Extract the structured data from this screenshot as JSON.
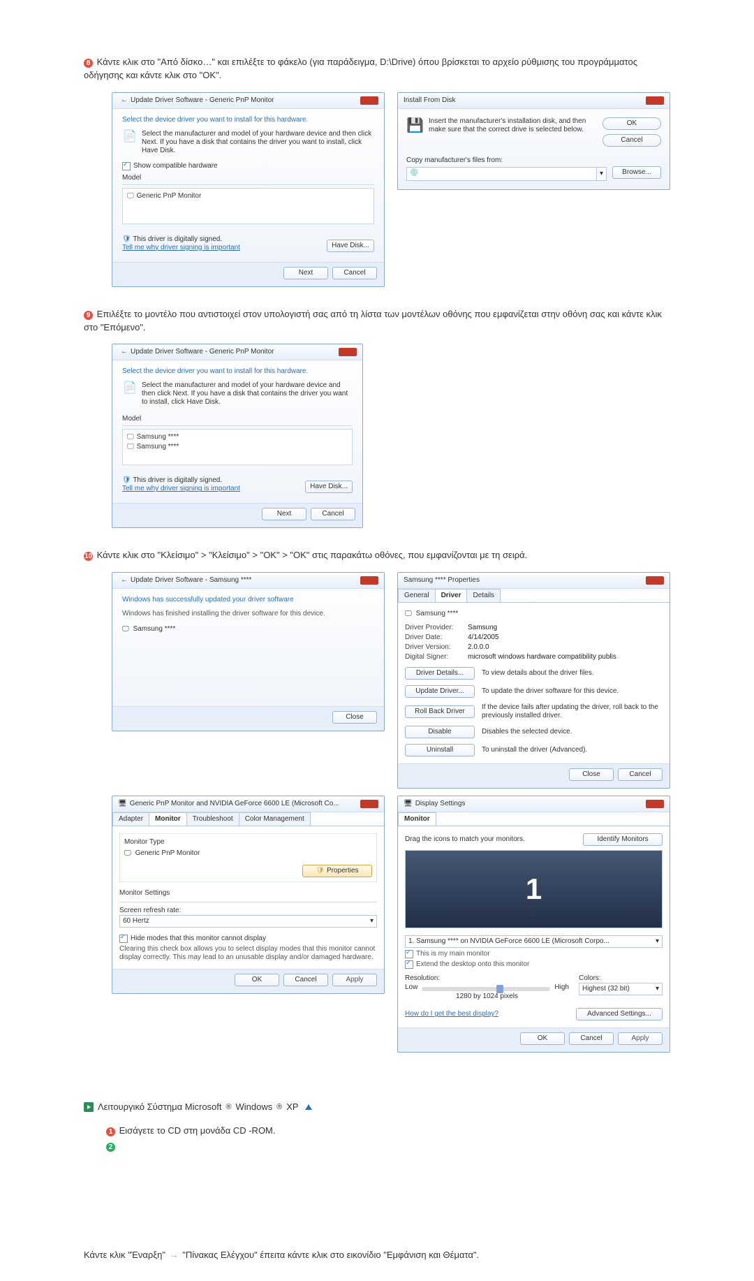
{
  "step8": {
    "text": "Κάντε κλικ στο \"Από δίσκο…\" και επιλέξτε το φάκελο (για παράδειγμα, D:\\Drive) όπου βρίσκεται το αρχείο ρύθμισης του προγράμματος οδήγησης και κάντε κλικ στο \"OK\"."
  },
  "updDrv": {
    "title": "Update Driver Software - Generic PnP Monitor",
    "heading": "Select the device driver you want to install for this hardware.",
    "desc": "Select the manufacturer and model of your hardware device and then click Next. If you have a disk that contains the driver you want to install, click Have Disk.",
    "showCompat": "Show compatible hardware",
    "modelLabel": "Model",
    "items": [
      "Generic PnP Monitor"
    ],
    "signed": "This driver is digitally signed.",
    "signedLink": "Tell me why driver signing is important",
    "haveDisk": "Have Disk...",
    "next": "Next",
    "cancel": "Cancel"
  },
  "ifd": {
    "title": "Install From Disk",
    "desc": "Insert the manufacturer's installation disk, and then make sure that the correct drive is selected below.",
    "ok": "OK",
    "cancel": "Cancel",
    "copyFrom": "Copy manufacturer's files from:",
    "browse": "Browse..."
  },
  "step9": {
    "text": "Επιλέξτε το μοντέλο που αντιστοιχεί στον υπολογιστή σας από τη λίστα των μοντέλων οθόνης που εμφανίζεται στην οθόνη σας και κάντε κλικ στο \"Επόμενο\"."
  },
  "updDrv2": {
    "items": [
      "Samsung ****",
      "Samsung ****"
    ]
  },
  "step10": {
    "text": "Κάντε κλικ στο \"Κλείσιμο\" > \"Κλείσιμο\" > \"OK\" > \"OK\" στις παρακάτω οθόνες, που εμφανίζονται με τη σειρά."
  },
  "updDrv3": {
    "title": "Update Driver Software - Samsung ****",
    "heading": "Windows has successfully updated your driver software",
    "desc": "Windows has finished installing the driver software for this device.",
    "item": "Samsung ****",
    "close": "Close"
  },
  "props": {
    "title": "Samsung **** Properties",
    "tabs": [
      "General",
      "Driver",
      "Details"
    ],
    "device": "Samsung ****",
    "provider_k": "Driver Provider:",
    "provider_v": "Samsung",
    "date_k": "Driver Date:",
    "date_v": "4/14/2005",
    "version_k": "Driver Version:",
    "version_v": "2.0.0.0",
    "signer_k": "Digital Signer:",
    "signer_v": "microsoft windows hardware compatibility publis",
    "btn_details": "Driver Details...",
    "btn_details_t": "To view details about the driver files.",
    "btn_update": "Update Driver...",
    "btn_update_t": "To update the driver software for this device.",
    "btn_rollback": "Roll Back Driver",
    "btn_rollback_t": "If the device fails after updating the driver, roll back to the previously installed driver.",
    "btn_disable": "Disable",
    "btn_disable_t": "Disables the selected device.",
    "btn_uninstall": "Uninstall",
    "btn_uninstall_t": "To uninstall the driver (Advanced).",
    "close": "Close",
    "cancel": "Cancel"
  },
  "monProps": {
    "title": "Generic PnP Monitor and NVIDIA GeForce 6600 LE (Microsoft Co...",
    "tabs": [
      "Adapter",
      "Monitor",
      "Troubleshoot",
      "Color Management"
    ],
    "typeLabel": "Monitor Type",
    "typeVal": "Generic PnP Monitor",
    "propertiesBtn": "Properties",
    "settingsLabel": "Monitor Settings",
    "refreshLabel": "Screen refresh rate:",
    "refreshVal": "60 Hertz",
    "hideModes": "Hide modes that this monitor cannot display",
    "hideModesDesc": "Clearing this check box allows you to select display modes that this monitor cannot display correctly. This may lead to an unusable display and/or damaged hardware.",
    "ok": "OK",
    "cancel": "Cancel",
    "apply": "Apply"
  },
  "dispSet": {
    "title": "Display Settings",
    "tab": "Monitor",
    "drag": "Drag the icons to match your monitors.",
    "identify": "Identify Monitors",
    "monitorSel": "1. Samsung **** on NVIDIA GeForce 6600 LE (Microsoft Corpo...",
    "main": "This is my main monitor",
    "extend": "Extend the desktop onto this monitor",
    "resLabel": "Resolution:",
    "low": "Low",
    "high": "High",
    "resVal": "1280 by 1024 pixels",
    "colorsLabel": "Colors:",
    "colorsVal": "Highest (32 bit)",
    "bestLink": "How do I get the best display?",
    "advanced": "Advanced Settings...",
    "ok": "OK",
    "cancel": "Cancel",
    "apply": "Apply"
  },
  "os": {
    "label_a": "Λειτουργικό Σύστημα Microsoft",
    "label_b": "Windows",
    "label_c": "XP"
  },
  "step1": {
    "text": "Εισάγετε το CD στη μονάδα CD -ROM."
  },
  "footer": {
    "text_a": "Κάντε κλικ \"Έναρξη\"",
    "text_b": "\"Πίνακας Ελέγχου\" έπειτα κάντε κλικ στο εικονίδιο \"Εμφάνιση και Θέματα\"."
  }
}
